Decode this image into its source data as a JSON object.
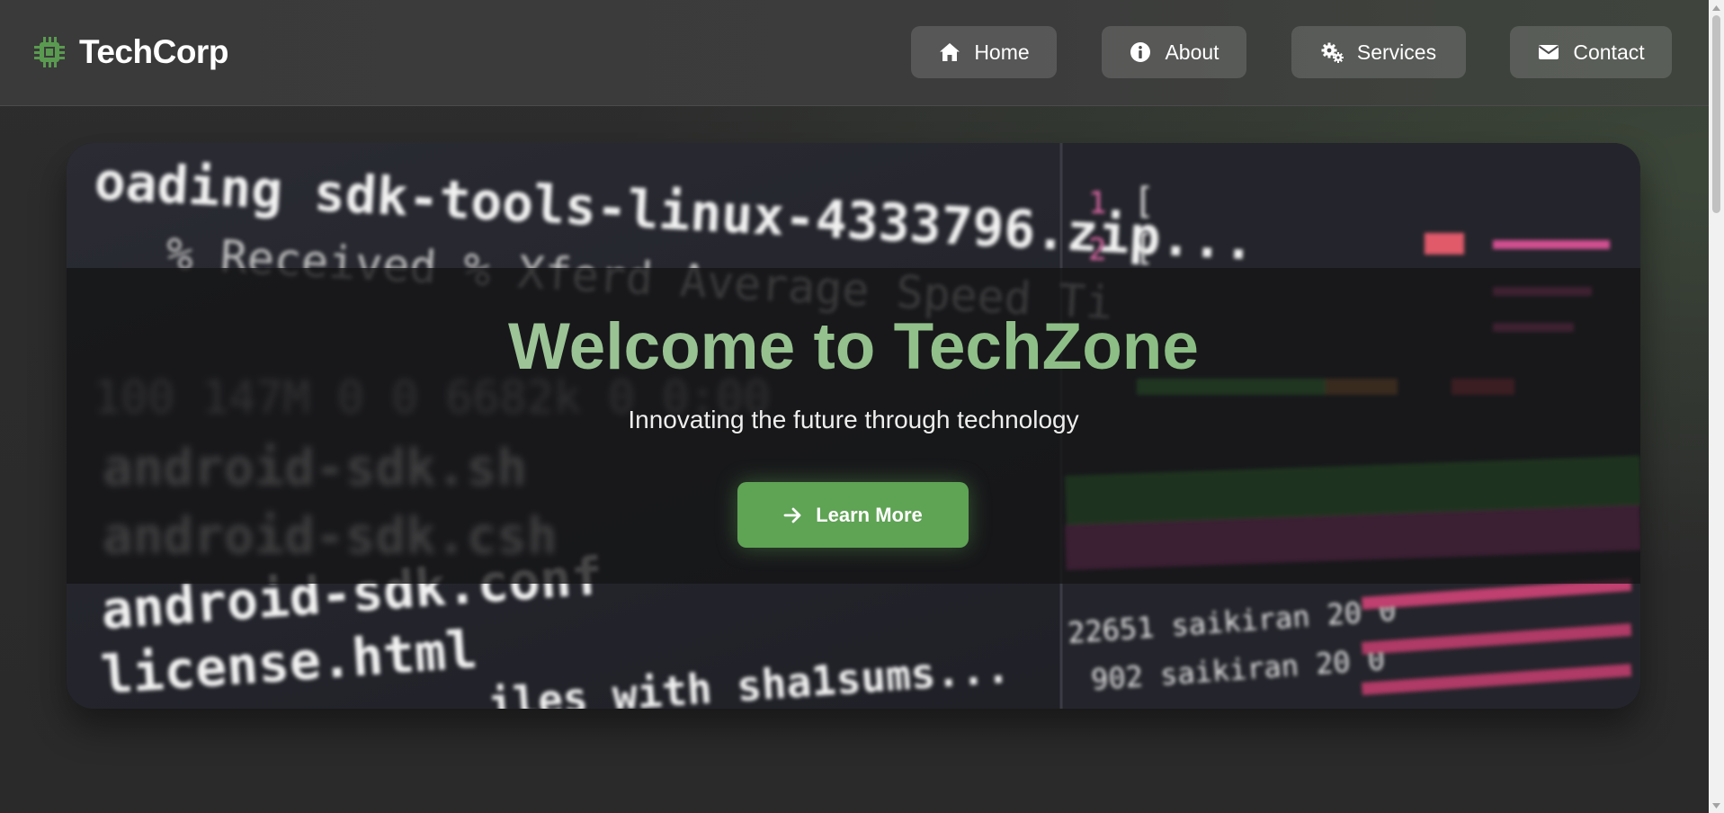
{
  "header": {
    "brand": "TechCorp",
    "brand_icon": "chip-icon",
    "nav": [
      {
        "label": "Home",
        "icon": "home-icon"
      },
      {
        "label": "About",
        "icon": "info-icon"
      },
      {
        "label": "Services",
        "icon": "cogs-icon"
      },
      {
        "label": "Contact",
        "icon": "envelope-icon"
      }
    ]
  },
  "hero": {
    "title": "Welcome to TechZone",
    "subtitle": "Innovating the future through technology",
    "cta_label": "Learn More",
    "cta_icon": "arrow-right-icon"
  },
  "colors": {
    "accent": "#5fa355",
    "title_gradient_start": "#a8c8a4",
    "title_gradient_end": "#7fb878",
    "header_bg": "#3a3a3a",
    "page_bg": "#2b2b2b"
  }
}
